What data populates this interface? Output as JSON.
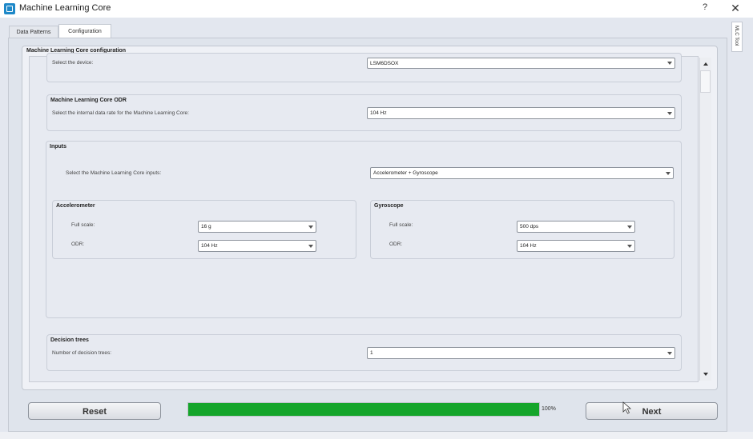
{
  "window": {
    "title": "Machine Learning Core",
    "help_label": "?",
    "close_label": "✕",
    "icon": "app-logo-icon"
  },
  "tabs": [
    {
      "label": "Data Patterns",
      "active": false
    },
    {
      "label": "Configuration",
      "active": true
    }
  ],
  "side_tab": {
    "label": "MLC Tool"
  },
  "config": {
    "title": "Machine Learning Core configuration",
    "device": {
      "label": "Select the device:",
      "value": "LSM6DSOX"
    },
    "odr": {
      "title": "Machine Learning Core ODR",
      "label": "Select the internal data rate for the Machine Learning Core:",
      "value": "104 Hz"
    },
    "inputs": {
      "title": "Inputs",
      "label": "Select the Machine Learning Core inputs:",
      "value": "Accelerometer + Gyroscope",
      "accelerometer": {
        "title": "Accelerometer",
        "full_scale_label": "Full scale:",
        "full_scale_value": "16 g",
        "odr_label": "ODR:",
        "odr_value": "104 Hz"
      },
      "gyroscope": {
        "title": "Gyroscope",
        "full_scale_label": "Full scale:",
        "full_scale_value": "500 dps",
        "odr_label": "ODR:",
        "odr_value": "104 Hz"
      }
    },
    "decision_trees": {
      "title": "Decision trees",
      "label": "Number of decision trees:",
      "value": "1"
    }
  },
  "bottom": {
    "reset_label": "Reset",
    "next_label": "Next",
    "progress_text": "100%",
    "progress_fraction": 1.0
  },
  "colors": {
    "progress": "#15a52b",
    "app_icon": "#1e88c8"
  }
}
